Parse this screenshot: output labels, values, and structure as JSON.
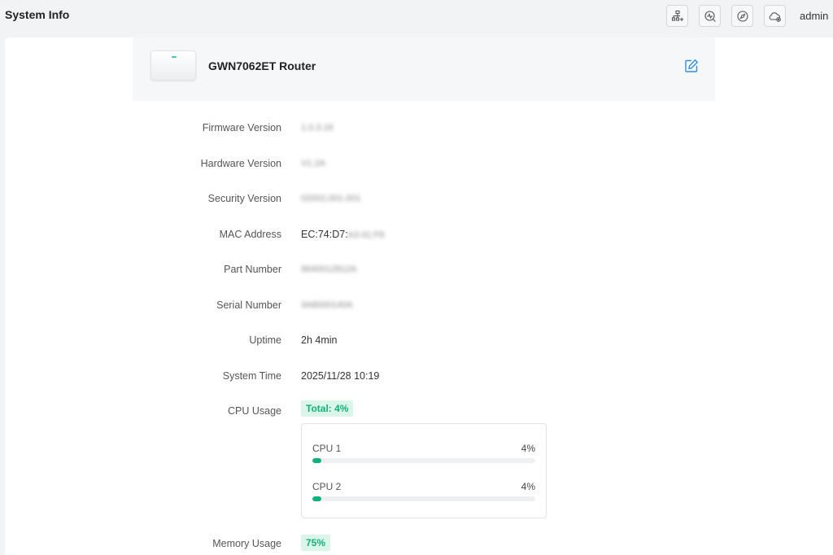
{
  "header": {
    "title": "System Info",
    "user": "admin",
    "icons": [
      "network-add-icon",
      "diagnose-icon",
      "compass-icon",
      "cloud-icon"
    ]
  },
  "device": {
    "name": "GWN7062ET Router",
    "image": "router-image"
  },
  "info": {
    "firmware_label": "Firmware Version",
    "firmware_value": "1.0.3.16",
    "hardware_label": "Hardware Version",
    "hardware_value": "V1.2A",
    "security_label": "Security Version",
    "security_value": "02002,001.001",
    "mac_label": "MAC Address",
    "mac_prefix": "EC:74:D7:",
    "mac_suffix": "A3:41:F8",
    "part_label": "Part Number",
    "part_value": "9640012812A",
    "serial_label": "Serial Number",
    "serial_value": "3A8000140A",
    "uptime_label": "Uptime",
    "uptime_value": "2h 4min",
    "system_time_label": "System Time",
    "system_time_value": "2025/11/28 10:19",
    "cpu_label": "CPU Usage",
    "cpu_total": "Total: 4%",
    "memory_label": "Memory Usage",
    "memory_value": "75%"
  },
  "cpus": [
    {
      "name": "CPU 1",
      "percent_label": "4%",
      "percent": 4
    },
    {
      "name": "CPU 2",
      "percent_label": "4%",
      "percent": 4
    }
  ],
  "colors": {
    "accent": "#10b27a",
    "badge_bg": "#dcf5ea",
    "edit_icon": "#2f8fdf"
  }
}
